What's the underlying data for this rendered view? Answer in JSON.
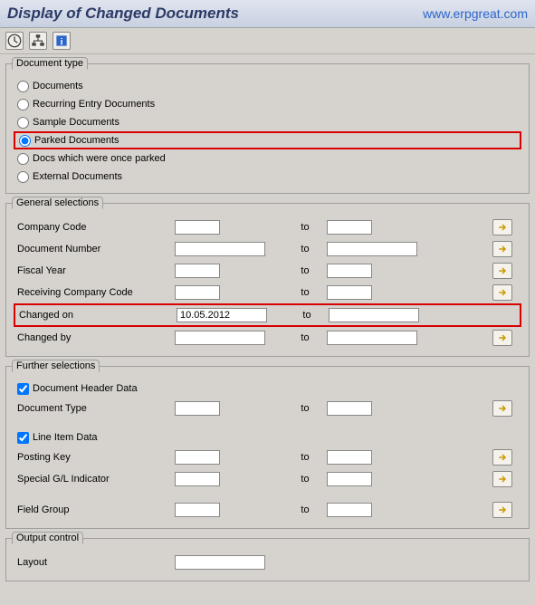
{
  "header": {
    "title": "Display of Changed Documents",
    "watermark": "www.erpgreat.com"
  },
  "toolbar": {
    "icons": [
      "clock-icon",
      "hierarchy-icon",
      "info-icon"
    ]
  },
  "doc_type": {
    "legend": "Document type",
    "options": [
      {
        "label": "Documents",
        "checked": false
      },
      {
        "label": "Recurring Entry Documents",
        "checked": false
      },
      {
        "label": "Sample Documents",
        "checked": false
      },
      {
        "label": "Parked Documents",
        "checked": true,
        "highlight": true
      },
      {
        "label": "Docs which were once parked",
        "checked": false
      },
      {
        "label": "External Documents",
        "checked": false
      }
    ]
  },
  "general": {
    "legend": "General selections",
    "to_label": "to",
    "rows": [
      {
        "label": "Company Code",
        "from": "",
        "to": "",
        "arrow": true
      },
      {
        "label": "Document Number",
        "from": "",
        "to": "",
        "arrow": true
      },
      {
        "label": "Fiscal Year",
        "from": "",
        "to": "",
        "arrow": true
      },
      {
        "label": "Receiving Company Code",
        "from": "",
        "to": "",
        "arrow": true
      },
      {
        "label": "Changed on",
        "from": "10.05.2012",
        "to": "",
        "arrow": false,
        "highlight": true
      },
      {
        "label": "Changed by",
        "from": "",
        "to": "",
        "arrow": true
      }
    ]
  },
  "further": {
    "legend": "Further selections",
    "to_label": "to",
    "check1": {
      "label": "Document Header Data",
      "checked": true
    },
    "rows1": [
      {
        "label": "Document Type",
        "from": "",
        "to": "",
        "arrow": true
      }
    ],
    "check2": {
      "label": "Line Item Data",
      "checked": true
    },
    "rows2": [
      {
        "label": "Posting Key",
        "from": "",
        "to": "",
        "arrow": true
      },
      {
        "label": "Special G/L Indicator",
        "from": "",
        "to": "",
        "arrow": true
      }
    ],
    "rows3": [
      {
        "label": "Field Group",
        "from": "",
        "to": "",
        "arrow": true
      }
    ]
  },
  "output": {
    "legend": "Output control",
    "rows": [
      {
        "label": "Layout",
        "from": ""
      }
    ]
  }
}
